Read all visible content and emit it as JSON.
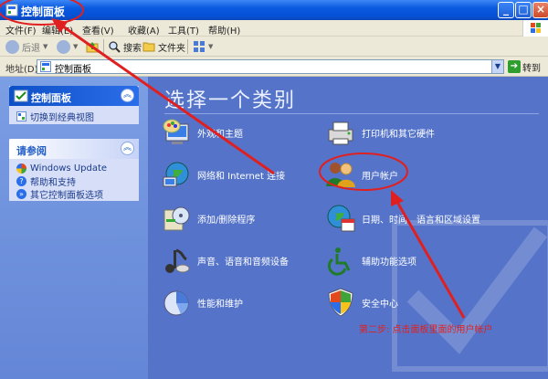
{
  "window": {
    "title": "控制面板"
  },
  "menu": [
    "文件(F)",
    "编辑(E)",
    "查看(V)",
    "收藏(A)",
    "工具(T)",
    "帮助(H)"
  ],
  "toolbar": {
    "back": "后退",
    "search": "搜索",
    "folders": "文件夹"
  },
  "address": {
    "label": "地址(D)",
    "value": "控制面板",
    "go": "转到"
  },
  "left_pane": {
    "panel_title": "控制面板",
    "switch_view": "切换到经典视图",
    "see_also_title": "请参阅",
    "see_also": [
      "Windows Update",
      "帮助和支持",
      "其它控制面板选项"
    ]
  },
  "content": {
    "heading": "选择一个类别",
    "categories": [
      {
        "label": "外观和主题",
        "icon": "appearance-icon"
      },
      {
        "label": "打印机和其它硬件",
        "icon": "printer-icon"
      },
      {
        "label": "网络和 Internet 连接",
        "icon": "network-icon"
      },
      {
        "label": "用户帐户",
        "icon": "users-icon"
      },
      {
        "label": "添加/删除程序",
        "icon": "add-remove-icon"
      },
      {
        "label": "日期、时间、语言和区域设置",
        "icon": "datetime-icon"
      },
      {
        "label": "声音、语音和音频设备",
        "icon": "sound-icon"
      },
      {
        "label": "辅助功能选项",
        "icon": "accessibility-icon"
      },
      {
        "label": "性能和维护",
        "icon": "performance-icon"
      },
      {
        "label": "安全中心",
        "icon": "security-icon"
      }
    ]
  },
  "annotation": {
    "step_text": "第二步: 点击面板里面的用户帐户",
    "color": "#e02020"
  }
}
